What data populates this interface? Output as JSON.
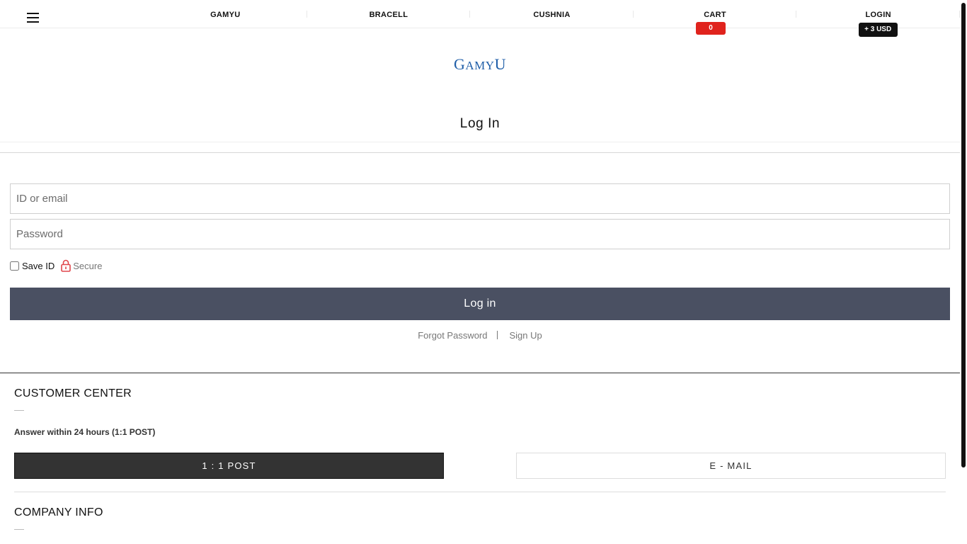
{
  "nav": {
    "menu_icon": "hamburger-icon",
    "items": [
      {
        "label": "GAMYU"
      },
      {
        "label": "BRACELL"
      },
      {
        "label": "CUSHNIA"
      },
      {
        "label": "CART",
        "badge": "0"
      },
      {
        "label": "LOGIN",
        "badge": "+ 3 USD"
      }
    ]
  },
  "logo": {
    "text_cap": "G",
    "text_rest_1": "AMY",
    "text_cap_2": "U",
    "color": "#1f5ea8"
  },
  "page": {
    "title": "Log In"
  },
  "form": {
    "id_placeholder": "ID or email",
    "password_placeholder": "Password",
    "save_id_label": "Save ID",
    "secure_label": "Secure",
    "secure_icon": "lock-icon",
    "submit_label": "Log in",
    "forgot_label": "Forgot Password",
    "signup_label": "Sign Up",
    "button_color": "#4a5062"
  },
  "footer": {
    "customer_center": {
      "title": "CUSTOMER CENTER",
      "description": "Answer within 24 hours (1:1 POST)",
      "post_button": "1 : 1 POST",
      "email_button": "E - MAIL"
    },
    "company_info": {
      "title": "COMPANY INFO"
    }
  },
  "colors": {
    "cart_badge": "#e0231d",
    "login_badge": "#111111"
  }
}
